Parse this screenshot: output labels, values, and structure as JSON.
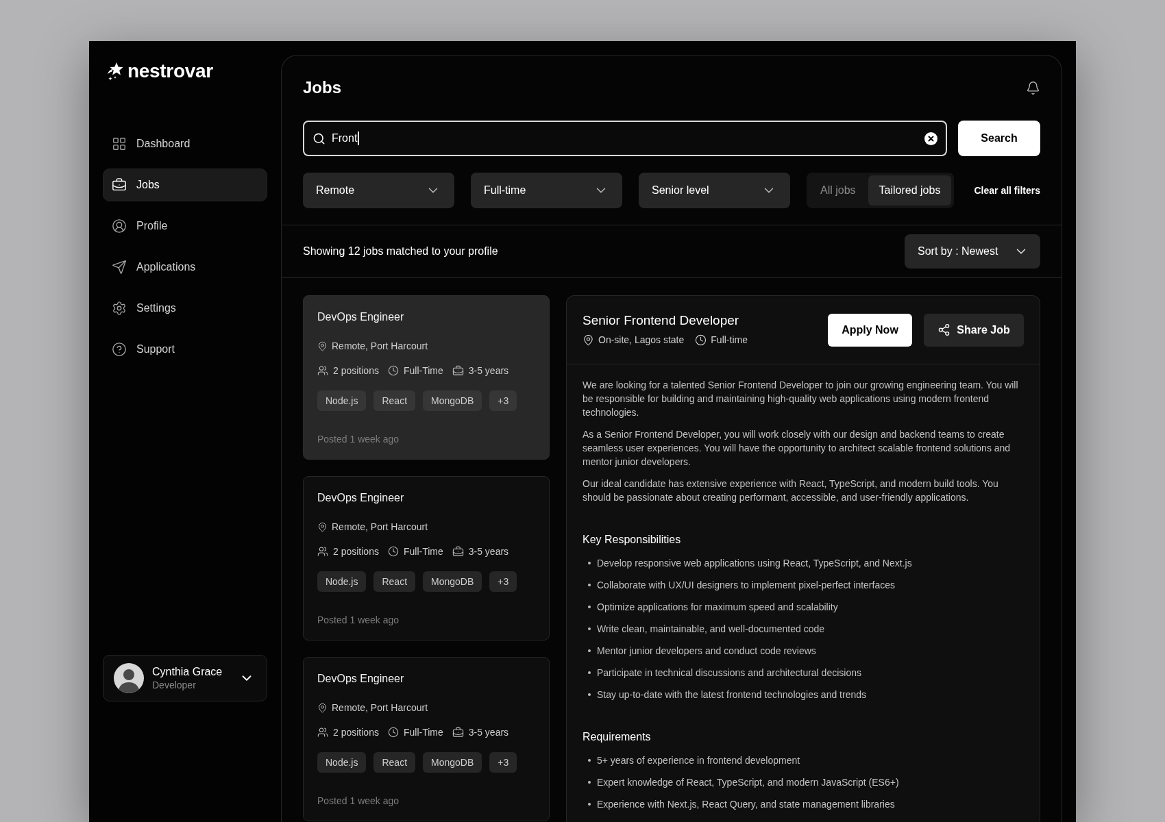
{
  "sidebar": {
    "logo": "nestrovar",
    "nav": [
      {
        "label": "Dashboard",
        "selected": false
      },
      {
        "label": "Jobs",
        "selected": true
      },
      {
        "label": "Profile",
        "selected": false
      },
      {
        "label": "Applications",
        "selected": false
      },
      {
        "label": "Settings",
        "selected": false
      },
      {
        "label": "Support",
        "selected": false
      }
    ],
    "user": {
      "name": "Cynthia Grace",
      "role": "Developer"
    }
  },
  "header": {
    "title": "Jobs"
  },
  "search": {
    "value": "Front",
    "button": "Search"
  },
  "filters": {
    "dropdowns": [
      "Remote",
      "Full-time",
      "Senior level"
    ],
    "scope": [
      {
        "label": "All jobs",
        "selected": false
      },
      {
        "label": "Tailored jobs",
        "selected": true
      }
    ],
    "clear": "Clear all filters"
  },
  "results": {
    "summary": "Showing 12 jobs matched to your profile",
    "sort": "Sort by : Newest"
  },
  "job_cards": [
    {
      "title": "DevOps Engineer",
      "location": "Remote, Port Harcourt",
      "positions": "2 positions",
      "type": "Full-Time",
      "experience": "3-5 years",
      "tags": [
        "Node.js",
        "React",
        "MongoDB",
        "+3"
      ],
      "posted": "Posted 1 week ago",
      "selected": true
    },
    {
      "title": "DevOps Engineer",
      "location": "Remote, Port Harcourt",
      "positions": "2 positions",
      "type": "Full-Time",
      "experience": "3-5 years",
      "tags": [
        "Node.js",
        "React",
        "MongoDB",
        "+3"
      ],
      "posted": "Posted 1 week ago",
      "selected": false
    },
    {
      "title": "DevOps Engineer",
      "location": "Remote, Port Harcourt",
      "positions": "2 positions",
      "type": "Full-Time",
      "experience": "3-5 years",
      "tags": [
        "Node.js",
        "React",
        "MongoDB",
        "+3"
      ],
      "posted": "Posted 1 week ago",
      "selected": false
    }
  ],
  "job_detail": {
    "title": "Senior Frontend Developer",
    "location": "On-site, Lagos state",
    "type": "Full-time",
    "apply": "Apply Now",
    "share": "Share Job",
    "description": [
      "We are looking for a talented Senior Frontend Developer to join our growing engineering team. You will be responsible for building and maintaining high-quality web applications using modern frontend technologies.",
      "As a Senior Frontend Developer, you will work closely with our design and backend teams to create seamless user experiences. You will have the opportunity to architect scalable frontend solutions and mentor junior developers.",
      "Our ideal candidate has extensive experience with React, TypeScript, and modern build tools. You should be passionate about creating performant, accessible, and user-friendly applications."
    ],
    "sections": [
      {
        "heading": "Key Responsibilities",
        "items": [
          "Develop responsive web applications using React, TypeScript, and Next.js",
          "Collaborate with UX/UI designers to implement pixel-perfect interfaces",
          "Optimize applications for maximum speed and scalability",
          "Write clean, maintainable, and well-documented code",
          "Mentor junior developers and conduct code reviews",
          "Participate in technical discussions and architectural decisions",
          "Stay up-to-date with the latest frontend technologies and trends"
        ]
      },
      {
        "heading": "Requirements",
        "items": [
          "5+ years of experience in frontend development",
          "Expert knowledge of React, TypeScript, and modern JavaScript (ES6+)",
          "Experience with Next.js, React Query, and state management libraries"
        ]
      }
    ]
  }
}
